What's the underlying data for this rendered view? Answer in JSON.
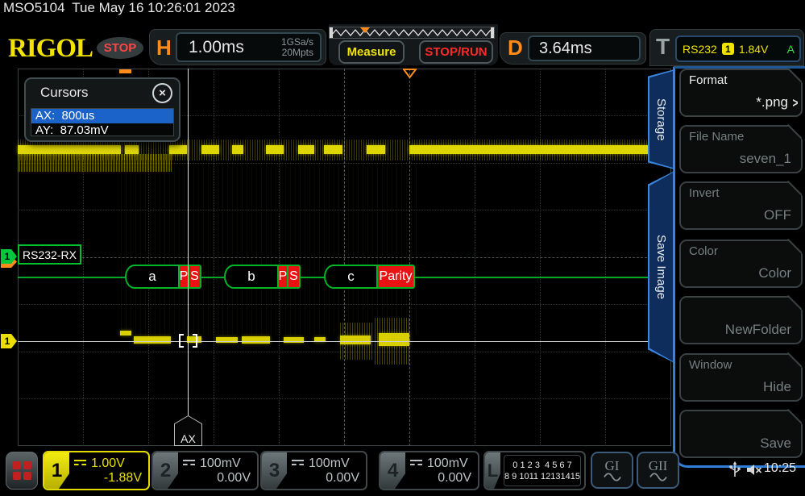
{
  "window": {
    "model": "MSO5104",
    "datetime": "Tue May 16 10:26:01 2023"
  },
  "header": {
    "logo": "RIGOL",
    "run_state": "STOP",
    "horizontal": {
      "label": "H",
      "timebase": "1.00ms",
      "sample_rate": "1GSa/s",
      "memory_depth": "20Mpts"
    },
    "measure_label": "Measure",
    "stop_run_label": "STOP/RUN",
    "delay": {
      "label": "D",
      "value": "3.64ms"
    },
    "trigger": {
      "label": "T",
      "type": "RS232",
      "source": "1",
      "level": "1.84V",
      "mode": "A"
    }
  },
  "cursors_popup": {
    "title": "Cursors",
    "close_icon": "×",
    "rows": [
      {
        "text": "AX:  800us"
      },
      {
        "text": "AY:  87.03mV"
      }
    ]
  },
  "waveform": {
    "decode_label": "RS232-RX",
    "decode_marker": "1",
    "channel_marker": "1",
    "ax_flag": "AX",
    "frames": [
      {
        "data": "a",
        "cells": [
          "P",
          "S"
        ]
      },
      {
        "data": "b",
        "cells": [
          "P",
          "S"
        ]
      },
      {
        "data": "c",
        "cells": [
          "Parity"
        ]
      }
    ]
  },
  "sidebar": {
    "tabs": [
      {
        "label": "Storage"
      },
      {
        "label": "Save Image"
      }
    ],
    "items": [
      {
        "label": "Format",
        "value": "*.png",
        "chevron": ">"
      },
      {
        "label": "File Name",
        "value": "seven_1"
      },
      {
        "label": "Invert",
        "value": "OFF"
      },
      {
        "label": "Color",
        "value": "Color"
      },
      {
        "label": "",
        "value": "NewFolder"
      },
      {
        "label": "Window",
        "value": "Hide"
      },
      {
        "label": "",
        "value": "Save"
      }
    ]
  },
  "bottom_bar": {
    "channels": [
      {
        "num": "1",
        "scale": "1.00V",
        "offset": "-1.88V"
      },
      {
        "num": "2",
        "scale": "100mV",
        "offset": "0.00V"
      },
      {
        "num": "3",
        "scale": "100mV",
        "offset": "0.00V"
      },
      {
        "num": "4",
        "scale": "100mV",
        "offset": "0.00V"
      }
    ],
    "logic": {
      "label": "L",
      "row1": "0 1 2 3  4 5 6 7",
      "row2": "8 9 1011 12131415"
    },
    "gen1": "GI",
    "gen2": "GII",
    "clock": "10:25"
  },
  "colors": {
    "channel_yellow": "#e8e000",
    "decode_green": "#00b428",
    "frame_red": "#e81212",
    "accent_orange": "#ff8c1a",
    "sidebar_blue": "#2f7fd6",
    "highlight_blue": "#1b63c8"
  }
}
